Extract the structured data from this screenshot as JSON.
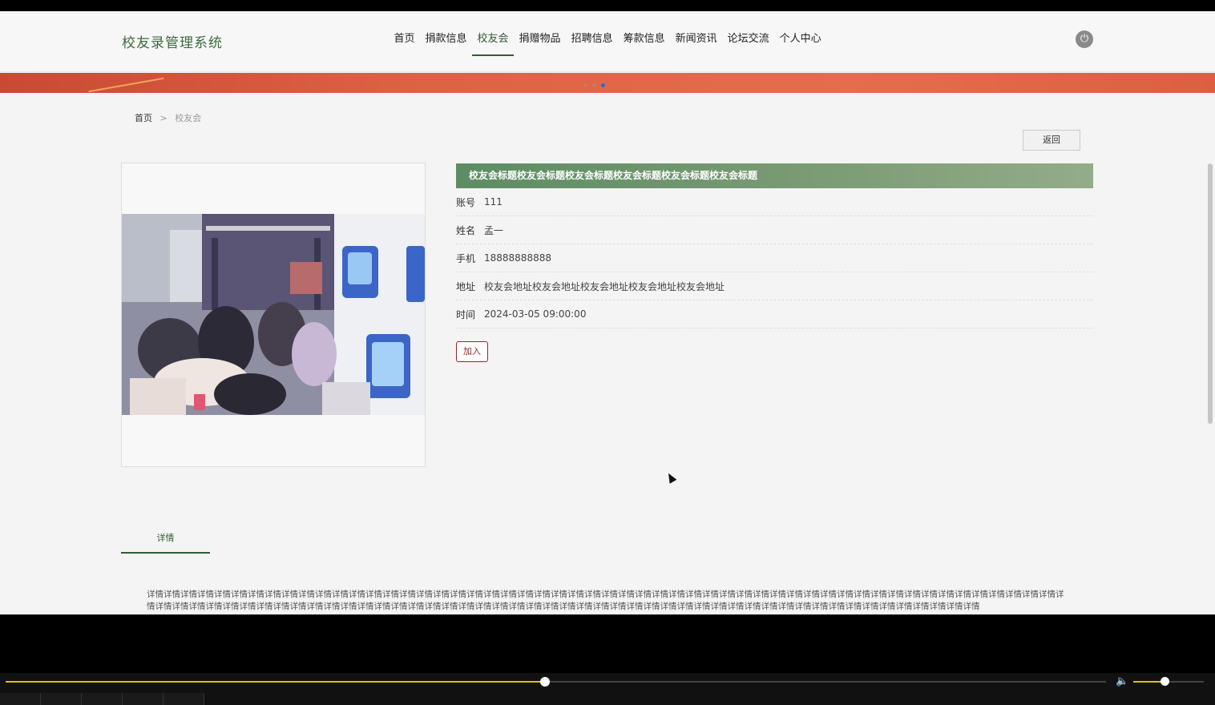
{
  "app": {
    "title": "校友录管理系统"
  },
  "nav": {
    "items": [
      {
        "label": "首页",
        "active": false
      },
      {
        "label": "捐款信息",
        "active": false
      },
      {
        "label": "校友会",
        "active": true
      },
      {
        "label": "捐赠物品",
        "active": false
      },
      {
        "label": "招聘信息",
        "active": false
      },
      {
        "label": "筹款信息",
        "active": false
      },
      {
        "label": "新闻资讯",
        "active": false
      },
      {
        "label": "论坛交流",
        "active": false
      },
      {
        "label": "个人中心",
        "active": false
      }
    ],
    "power_icon": "power-icon"
  },
  "banner": {
    "slide_count": 3,
    "active_slide": 3
  },
  "breadcrumb": {
    "home": "首页",
    "separator": ">",
    "current": "校友会"
  },
  "back_button": {
    "label": "返回"
  },
  "detail": {
    "title": "校友会标题校友会标题校友会标题校友会标题校友会标题校友会标题",
    "fields": [
      {
        "label": "账号",
        "value": "111"
      },
      {
        "label": "姓名",
        "value": "孟一"
      },
      {
        "label": "手机",
        "value": "18888888888"
      },
      {
        "label": "地址",
        "value": "校友会地址校友会地址校友会地址校友会地址校友会地址"
      },
      {
        "label": "时间",
        "value": "2024-03-05 09:00:00"
      }
    ],
    "join_label": "加入"
  },
  "tabs": {
    "detail_label": "详情"
  },
  "detail_body": "详情详情详情详情详情详情详情详情详情详情详情详情详情详情详情详情详情详情详情详情详情详情详情详情详情详情详情详情详情详情详情详情详情详情详情详情详情详情详情详情详情详情详情详情详情详情详情详情详情详情详情详情详情详情详情详情详情详情详情详情详情详情详情详情详情详情详情详情详情详情详情详情详情详情详情详情详情详情详情详情详情详情详情详情详情详情详情详情详情详情详情详情详情详情详情详情详情详情详情详情详情详情详情详情",
  "player": {
    "progress_fraction": 0.49,
    "volume_fraction": 0.44,
    "volume_icon": "speaker-icon",
    "accent_color": "#e0c200"
  },
  "colors": {
    "brand_green": "#2f5d31",
    "banner_red": "#de6244",
    "join_red": "#8b2a2a"
  }
}
